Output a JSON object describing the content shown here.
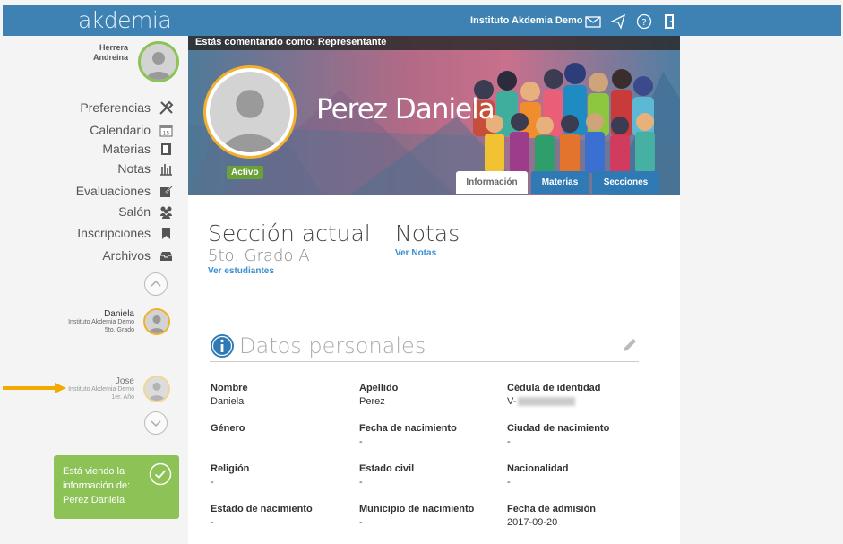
{
  "header": {
    "logo": "akdemia",
    "institution": "Instituto Akdemia Demo",
    "icons": [
      "mail-icon",
      "send-icon",
      "help-icon",
      "logout-icon"
    ]
  },
  "user": {
    "last_name": "Herrera",
    "first_name": "Andreina"
  },
  "menu": [
    {
      "label": "Preferencias",
      "icon": "tools-icon"
    },
    {
      "label": "Calendario",
      "icon": "calendar-icon"
    },
    {
      "label": "Materias",
      "icon": "book-icon"
    },
    {
      "label": "Notas",
      "icon": "chart-icon"
    },
    {
      "label": "Evaluaciones",
      "icon": "edit-icon"
    },
    {
      "label": "Salón",
      "icon": "people-icon"
    },
    {
      "label": "Inscripciones",
      "icon": "bookmark-icon"
    },
    {
      "label": "Archivos",
      "icon": "inbox-icon"
    }
  ],
  "children": [
    {
      "name": "Daniela",
      "school": "Instituto Akdemia Demo",
      "grade": "5to. Grado"
    },
    {
      "name": "Jose",
      "school": "Instituto Akdemia Demo",
      "grade": "1er. Año"
    }
  ],
  "notice": {
    "text": "Está viendo la información de: Perez Daniela"
  },
  "banner": {
    "commenting": "Estás comentando como: Representante",
    "profile_name": "Perez Daniela",
    "status": "Activo"
  },
  "tabs": [
    {
      "label": "Información",
      "active": true
    },
    {
      "label": "Materias",
      "active": false
    },
    {
      "label": "Secciones",
      "active": false
    }
  ],
  "section": {
    "title": "Sección actual",
    "value": "5to. Grado A",
    "link": "Ver estudiantes"
  },
  "grades": {
    "title": "Notas",
    "link": "Ver Notas"
  },
  "personal": {
    "title": "Datos personales",
    "fields": [
      {
        "label": "Nombre",
        "value": "Daniela"
      },
      {
        "label": "Apellido",
        "value": "Perez"
      },
      {
        "label": "Cédula de identidad",
        "value": "V-"
      },
      {
        "label": "Género",
        "value": ""
      },
      {
        "label": "Fecha de nacimiento",
        "value": "-"
      },
      {
        "label": "Ciudad de nacimiento",
        "value": "-"
      },
      {
        "label": "Religión",
        "value": "-"
      },
      {
        "label": "Estado civil",
        "value": "-"
      },
      {
        "label": "Nacionalidad",
        "value": "-"
      },
      {
        "label": "Estado de nacimiento",
        "value": "-"
      },
      {
        "label": "Municipio de nacimiento",
        "value": "-"
      },
      {
        "label": "Fecha de admisión",
        "value": "2017-09-20"
      }
    ]
  },
  "colors": {
    "topbar": "#3d82b3",
    "active_green": "#6aa138",
    "notice_green": "#8cc256",
    "tab_blue": "#2f7ab5",
    "link_blue": "#3a8fd1",
    "avatar_ring": "#f2b02e"
  }
}
